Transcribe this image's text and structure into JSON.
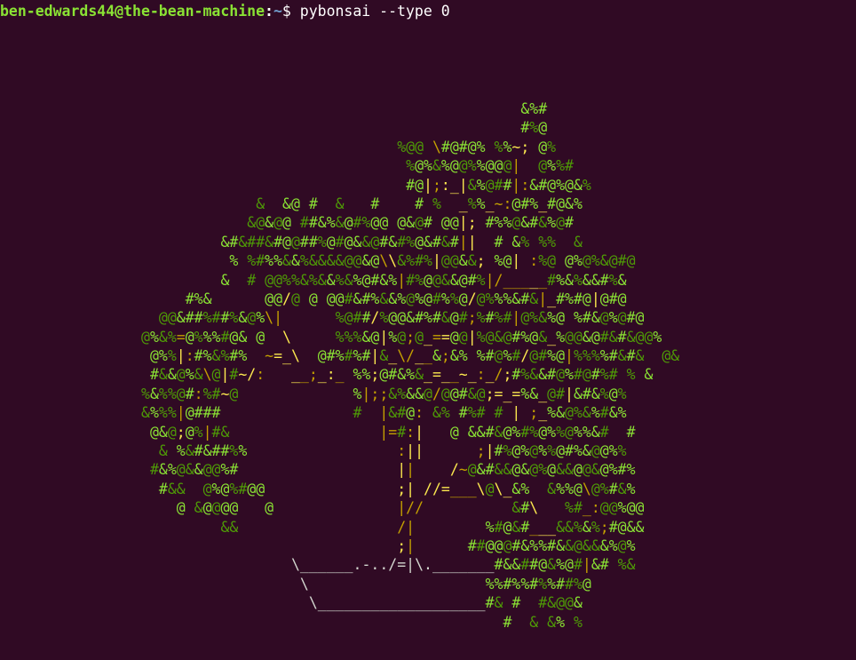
{
  "terminal": {
    "prompt": {
      "user_host": "ben-edwards44@the-bean-machine",
      "separator": ":",
      "cwd": "~",
      "dollar": "$",
      "command": "pybonsai --type 0"
    },
    "colors": {
      "background": "#300a24",
      "leaf_dark": "#4e9a06",
      "leaf_light": "#8ae234",
      "trunk": "#c4a000",
      "pot": "#d3d7cf"
    }
  },
  "bonsai": {
    "rows": [
      "                                                           &%#",
      "                                                           #%@",
      "                                             %@@ \\#@#@% %%~; @%",
      "                                              %@%&%@@%%@@@|  @%%#",
      "                                              #@|;:_|&%@##|:&#@%@&%",
      "                             &  &@ #  &   #    # %  _%%_~:@#%_#@&%",
      "                            &@&@@ ##&%&@#%@@ @&@# @@|; #%%@&#&%@#",
      "                         &#&##&#@@##%@#@&&@#&#%@&#&#||  # &% %%  &",
      "                          % %#%%&&%&&&&@@&@\\\\&%#%|@@&&; %@| :%@ @%@%&@#@",
      "                         &  # @@%%&%&&%&%@#&%|#%@@&&@#%|/_____#%&%&&#%&",
      "                     #%&      @@/@ @ @@#&#%&&%@%@#%%@/@%%%&#&|_#%#@|@#@",
      "                  @@&##%##%&@%\\|      %@##/%@@&#%#&@#;%#%#|@%&%@ %#&@%@#@",
      "                @%&%=@%%%#@& @  \\     %%%&@|%@;@_==@@|%@&@#%@&_%@@&@#&#&@@%",
      "                 @%%|:#%&%#%  ~=_\\  @#%#%#|&_\\/__&;&% %#@%#/@#%@|%%%%#&#&  @&",
      "                 #&&@%&\\@|#~/:   __;_:_ %%;@#&%&_=__~_:_/;#%&&#@%#@#%# % &",
      "                %&%%@#:%#~@             %|;;&%&&@/@@#&@;=_=%&_@#|&#&%@%",
      "                &%%%|@###               #  |&#@: &% #%# # | ;_%&@%&%#&%",
      "                 @&@;@%|#&                 |=#:|   @ &&#&@%#%@%%@%%&#  #",
      "                  & %&#&##%%                 :||      ;|#%@%@%%@#%&@@%%",
      "                 #&%@&&@@%#                  ||    /~@&#&&@&@%@&&@@&@%#%",
      "                  #&&  @%@%#@@               ;| //=___\\@\\_&%  &%%@\\@%#&%",
      "                    @ &@@@@   @              |//          &#\\   %#_:@@%@@",
      "                         &&                  /|        %#@&#___&&%&%;#@&&",
      "                                             ;|      ##@@@#&%%#&&@&&&%@%",
      "                                 \\______.-../=|\\._______#&&##@&%@#|&# %&",
      "                                  \\                    %%#%%#%%##%@",
      "                                   \\___________________#& #  #&@@&",
      "                                                         #  & &% %"
    ]
  }
}
